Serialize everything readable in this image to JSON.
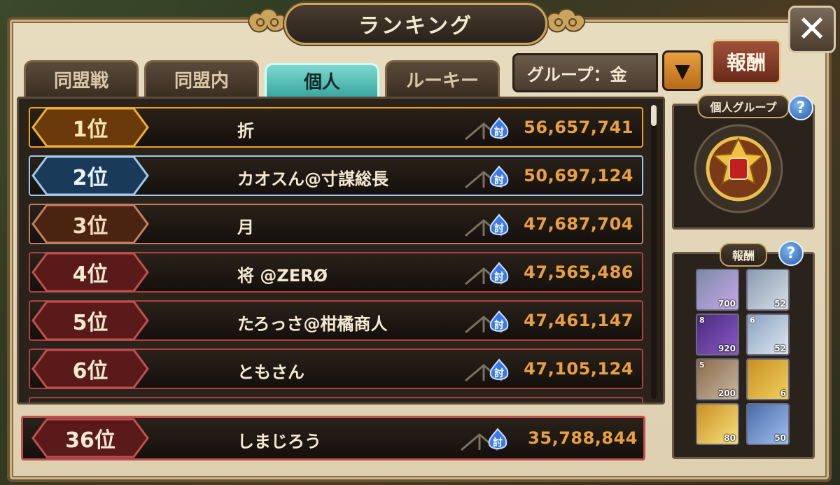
{
  "window": {
    "title": "ランキング",
    "close_label": "✕"
  },
  "tabs": [
    {
      "label": "同盟戦",
      "active": false
    },
    {
      "label": "同盟内",
      "active": false
    },
    {
      "label": "個人",
      "active": true
    },
    {
      "label": "ルーキー",
      "active": false
    }
  ],
  "group_select": {
    "value": "グループ：金",
    "arrow": "▼"
  },
  "reward_button": {
    "label": "報酬"
  },
  "rankings": [
    {
      "rank": "1位",
      "name": "折",
      "score": "56,657,741",
      "tier": "gold"
    },
    {
      "rank": "2位",
      "name": "カオスん@寸謀総長",
      "score": "50,697,124",
      "tier": "silver"
    },
    {
      "rank": "3位",
      "name": "月",
      "score": "47,687,704",
      "tier": "bronze"
    },
    {
      "rank": "4位",
      "name": "将 @ZERØ",
      "score": "47,565,486",
      "tier": "red"
    },
    {
      "rank": "5位",
      "name": "たろっさ@柑橘商人",
      "score": "47,461,147",
      "tier": "red"
    },
    {
      "rank": "6位",
      "name": "ともさん",
      "score": "47,105,124",
      "tier": "red"
    }
  ],
  "self": {
    "rank": "36位",
    "name": "しまじろう",
    "score": "35,788,844"
  },
  "row_icon_text": "討",
  "side": {
    "group_title": "個人グループ",
    "reward_title": "報酬",
    "help_label": "?"
  },
  "rewards": [
    {
      "qty": "700",
      "star": "",
      "icon": "gem-pile-icon"
    },
    {
      "qty": "52",
      "star": "",
      "icon": "scroll-icon"
    },
    {
      "qty": "920",
      "star": "8",
      "icon": "purple-chest-icon"
    },
    {
      "qty": "52",
      "star": "6",
      "icon": "silver-cards-icon"
    },
    {
      "qty": "200",
      "star": "5",
      "icon": "silver-ore-icon"
    },
    {
      "qty": "6",
      "star": "",
      "icon": "gold-chest-icon"
    },
    {
      "qty": "80",
      "star": "",
      "icon": "gold-ticket-icon"
    },
    {
      "qty": "50",
      "star": "",
      "icon": "blue-ticket-icon"
    }
  ],
  "colors": {
    "score": "#e8a040",
    "gold": "#f0a020",
    "silver": "#a0c8e8",
    "bronze": "#c08060",
    "red": "#b04040",
    "active_tab": "#3aa8a0"
  }
}
